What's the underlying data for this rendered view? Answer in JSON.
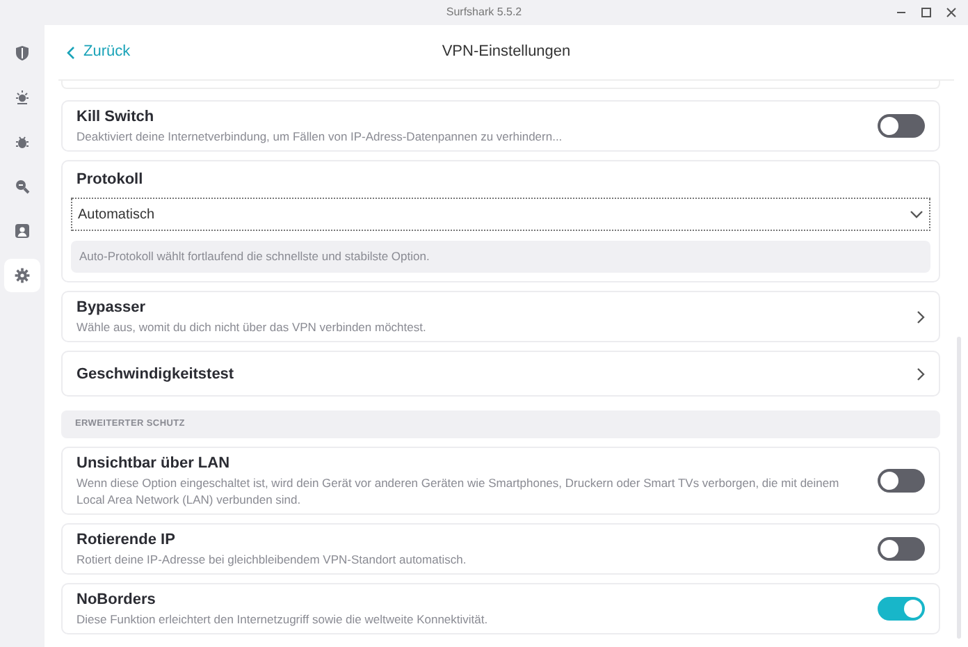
{
  "window": {
    "title": "Surfshark 5.5.2"
  },
  "sidebar": {
    "items": [
      {
        "selected": false
      },
      {
        "selected": false
      },
      {
        "selected": false
      },
      {
        "selected": false
      },
      {
        "selected": false
      },
      {
        "selected": true
      }
    ]
  },
  "header": {
    "back": "Zurück",
    "title": "VPN-Einstellungen"
  },
  "settings": [
    {
      "kind": "toggle",
      "title": "Kill Switch",
      "description": "Deaktiviert deine Internetverbindung, um Fällen von IP-Adress-Datenpannen zu verhindern...",
      "on": false
    },
    {
      "kind": "select",
      "title": "Protokoll",
      "value": "Automatisch",
      "hint": "Auto-Protokoll wählt fortlaufend die schnellste und stabilste Option."
    },
    {
      "kind": "link",
      "title": "Bypasser",
      "description": "Wähle aus, womit du dich nicht über das VPN verbinden möchtest."
    },
    {
      "kind": "link",
      "title": "Geschwindigkeitstest"
    },
    {
      "kind": "section",
      "title": "ERWEITERTER SCHUTZ"
    },
    {
      "kind": "toggle",
      "title": "Unsichtbar über LAN",
      "description": "Wenn diese Option eingeschaltet ist, wird dein Gerät vor anderen Geräten wie Smartphones, Druckern oder Smart TVs verborgen, die mit deinem Local Area Network (LAN) verbunden sind.",
      "on": false
    },
    {
      "kind": "toggle",
      "title": "Rotierende IP",
      "description": "Rotiert deine IP-Adresse bei gleichbleibendem VPN-Standort automatisch.",
      "on": false
    },
    {
      "kind": "toggle",
      "title": "NoBorders",
      "description": "Diese Funktion erleichtert den Internetzugriff sowie die weltweite Konnektivität.",
      "on": true
    }
  ]
}
